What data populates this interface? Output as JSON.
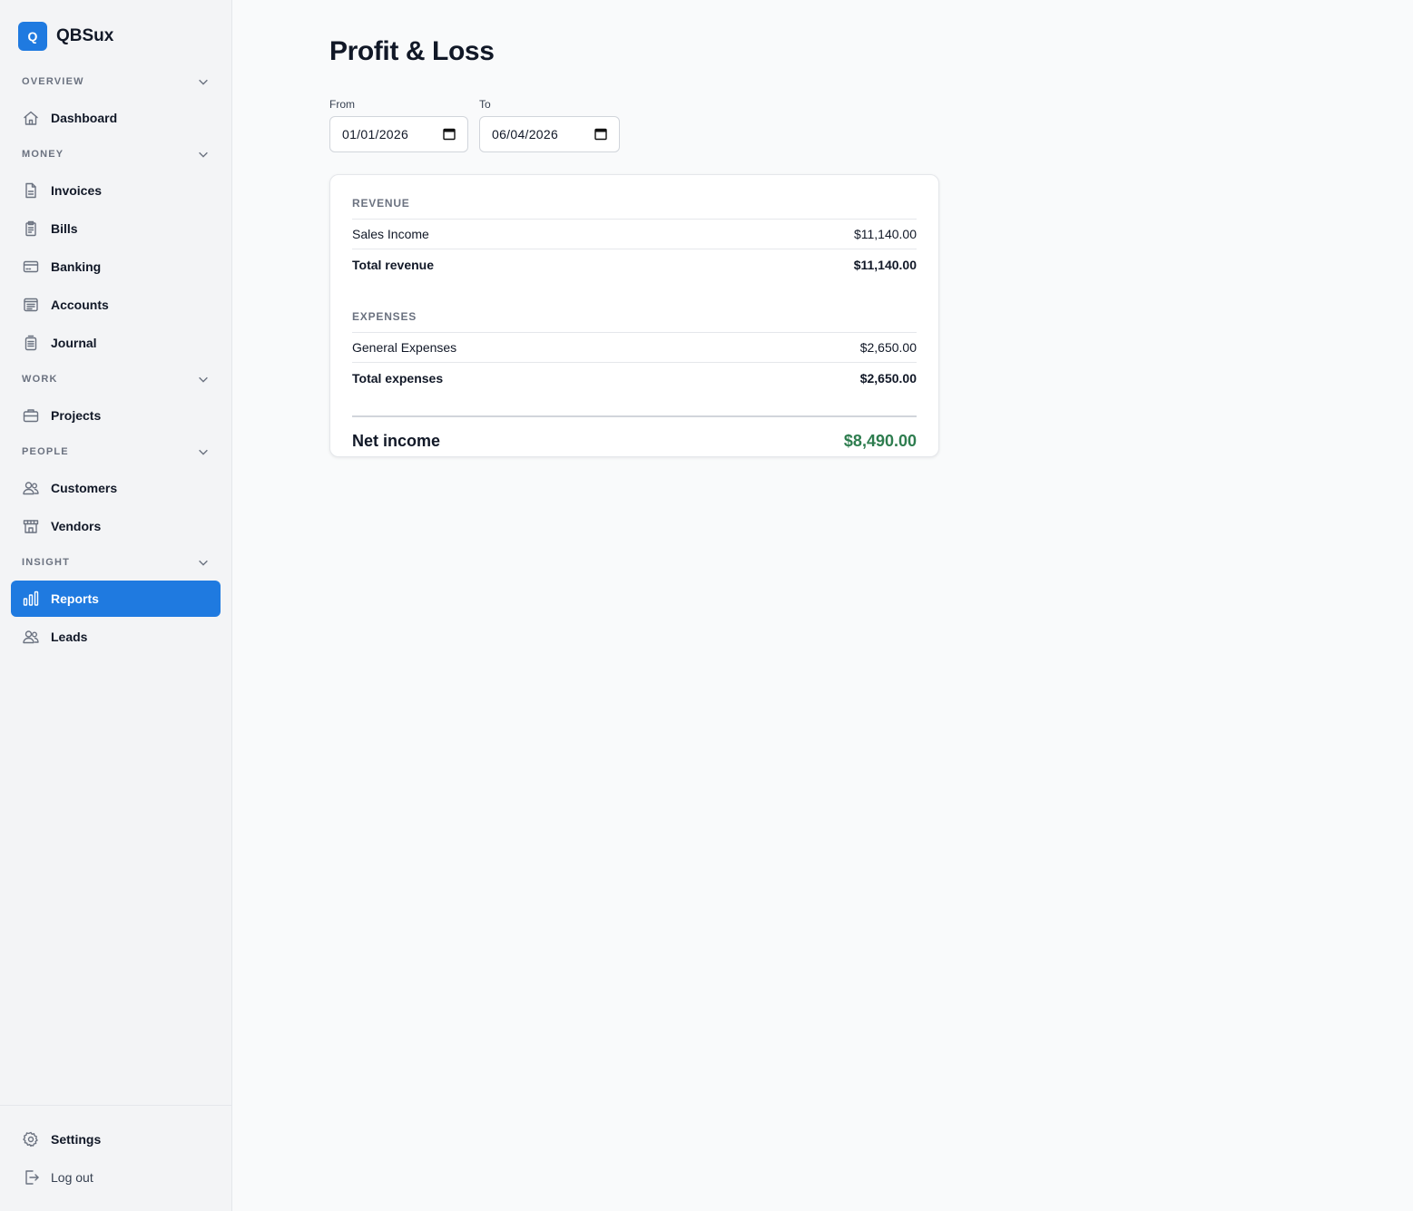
{
  "brand": {
    "logo_letter": "Q",
    "name": "QBSux"
  },
  "sidebar": {
    "sections": [
      {
        "label": "OVERVIEW",
        "items": [
          {
            "label": "Dashboard",
            "icon": "home-icon"
          }
        ]
      },
      {
        "label": "MONEY",
        "items": [
          {
            "label": "Invoices",
            "icon": "document-icon"
          },
          {
            "label": "Bills",
            "icon": "clipboard-icon"
          },
          {
            "label": "Banking",
            "icon": "bank-card-icon"
          },
          {
            "label": "Accounts",
            "icon": "ledger-icon"
          },
          {
            "label": "Journal",
            "icon": "journal-icon"
          }
        ]
      },
      {
        "label": "WORK",
        "items": [
          {
            "label": "Projects",
            "icon": "briefcase-icon"
          }
        ]
      },
      {
        "label": "PEOPLE",
        "items": [
          {
            "label": "Customers",
            "icon": "users-icon"
          },
          {
            "label": "Vendors",
            "icon": "storefront-icon"
          }
        ]
      },
      {
        "label": "INSIGHT",
        "items": [
          {
            "label": "Reports",
            "icon": "bar-chart-icon",
            "active": true
          },
          {
            "label": "Leads",
            "icon": "users-icon"
          }
        ]
      }
    ],
    "footer": {
      "settings_label": "Settings",
      "logout_label": "Log out"
    }
  },
  "page": {
    "title": "Profit & Loss"
  },
  "filters": {
    "from": {
      "label": "From",
      "value": "01/01/2026"
    },
    "to": {
      "label": "To",
      "value": "06/04/2026"
    }
  },
  "report": {
    "revenue": {
      "title": "REVENUE",
      "lines": [
        {
          "name": "Sales Income",
          "amount": "$11,140.00"
        }
      ],
      "total_label": "Total revenue",
      "total_amount": "$11,140.00"
    },
    "expenses": {
      "title": "EXPENSES",
      "lines": [
        {
          "name": "General Expenses",
          "amount": "$2,650.00"
        }
      ],
      "total_label": "Total expenses",
      "total_amount": "$2,650.00"
    },
    "net": {
      "label": "Net income",
      "amount": "$8,490.00"
    }
  },
  "colors": {
    "accent": "#1f7ae0",
    "positive": "#2e7d4f"
  }
}
